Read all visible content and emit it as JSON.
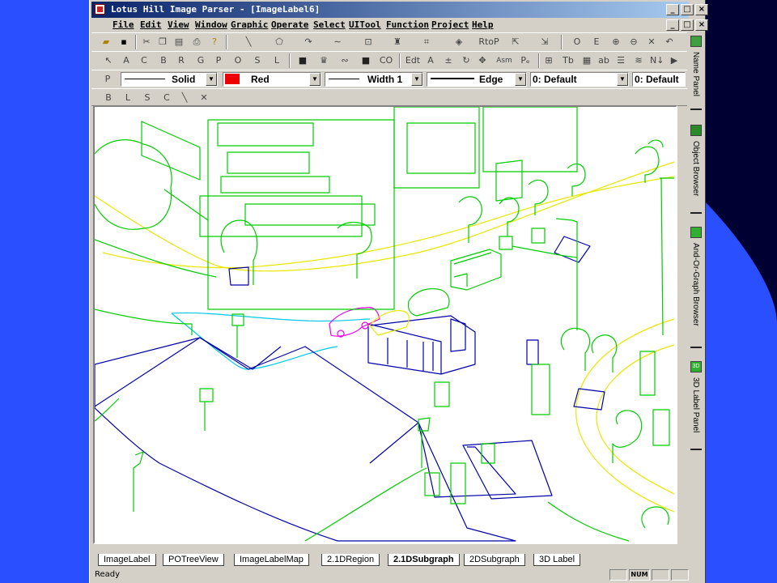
{
  "colors": {
    "slide_blue": "#2a4fff",
    "dark_panel": "#000033",
    "window_face": "#d4d0c8",
    "title_blue": "#0a246a",
    "green": "#00cc00",
    "yellow": "#e8e800",
    "blue": "#0000aa",
    "magenta": "#ee00ee",
    "cyan": "#00c8e8",
    "color_swatch": "#ee0000"
  },
  "window": {
    "title": "Lotus Hill Image Parser - [ImageLabel6]"
  },
  "menu": [
    "File",
    "Edit",
    "View",
    "Window",
    "Graphic",
    "Operate",
    "Select",
    "UITool",
    "Function",
    "Project",
    "Help"
  ],
  "toolbar1": {
    "rtop": "RtoP",
    "o": "O",
    "e": "E"
  },
  "toolbar2": {
    "co": "CO",
    "edt": "Edt",
    "a": "A",
    "asm": "Asm",
    "tb": "Tb",
    "ab": "ab"
  },
  "toolbar3": {
    "p": "P",
    "line_style": "Solid",
    "color": "Red",
    "width": "Width 1",
    "edge": "Edge",
    "layer1": "0: Default",
    "layer2": "0: Default"
  },
  "toolbar4": [
    "B",
    "L",
    "S",
    "C"
  ],
  "side_panels": [
    "Name Panel",
    "Object Browser",
    "And-Or-Graph Browser",
    "3D Label Panel"
  ],
  "side_icon_3d": "3D",
  "tabs": [
    "ImageLabel",
    "POTreeView",
    "ImageLabelMap",
    "2.1DRegion",
    "2.1DSubgraph",
    "2DSubgraph",
    "3D Label"
  ],
  "active_tab": "2.1DSubgraph",
  "status": {
    "text": "Ready",
    "num": "NUM"
  }
}
